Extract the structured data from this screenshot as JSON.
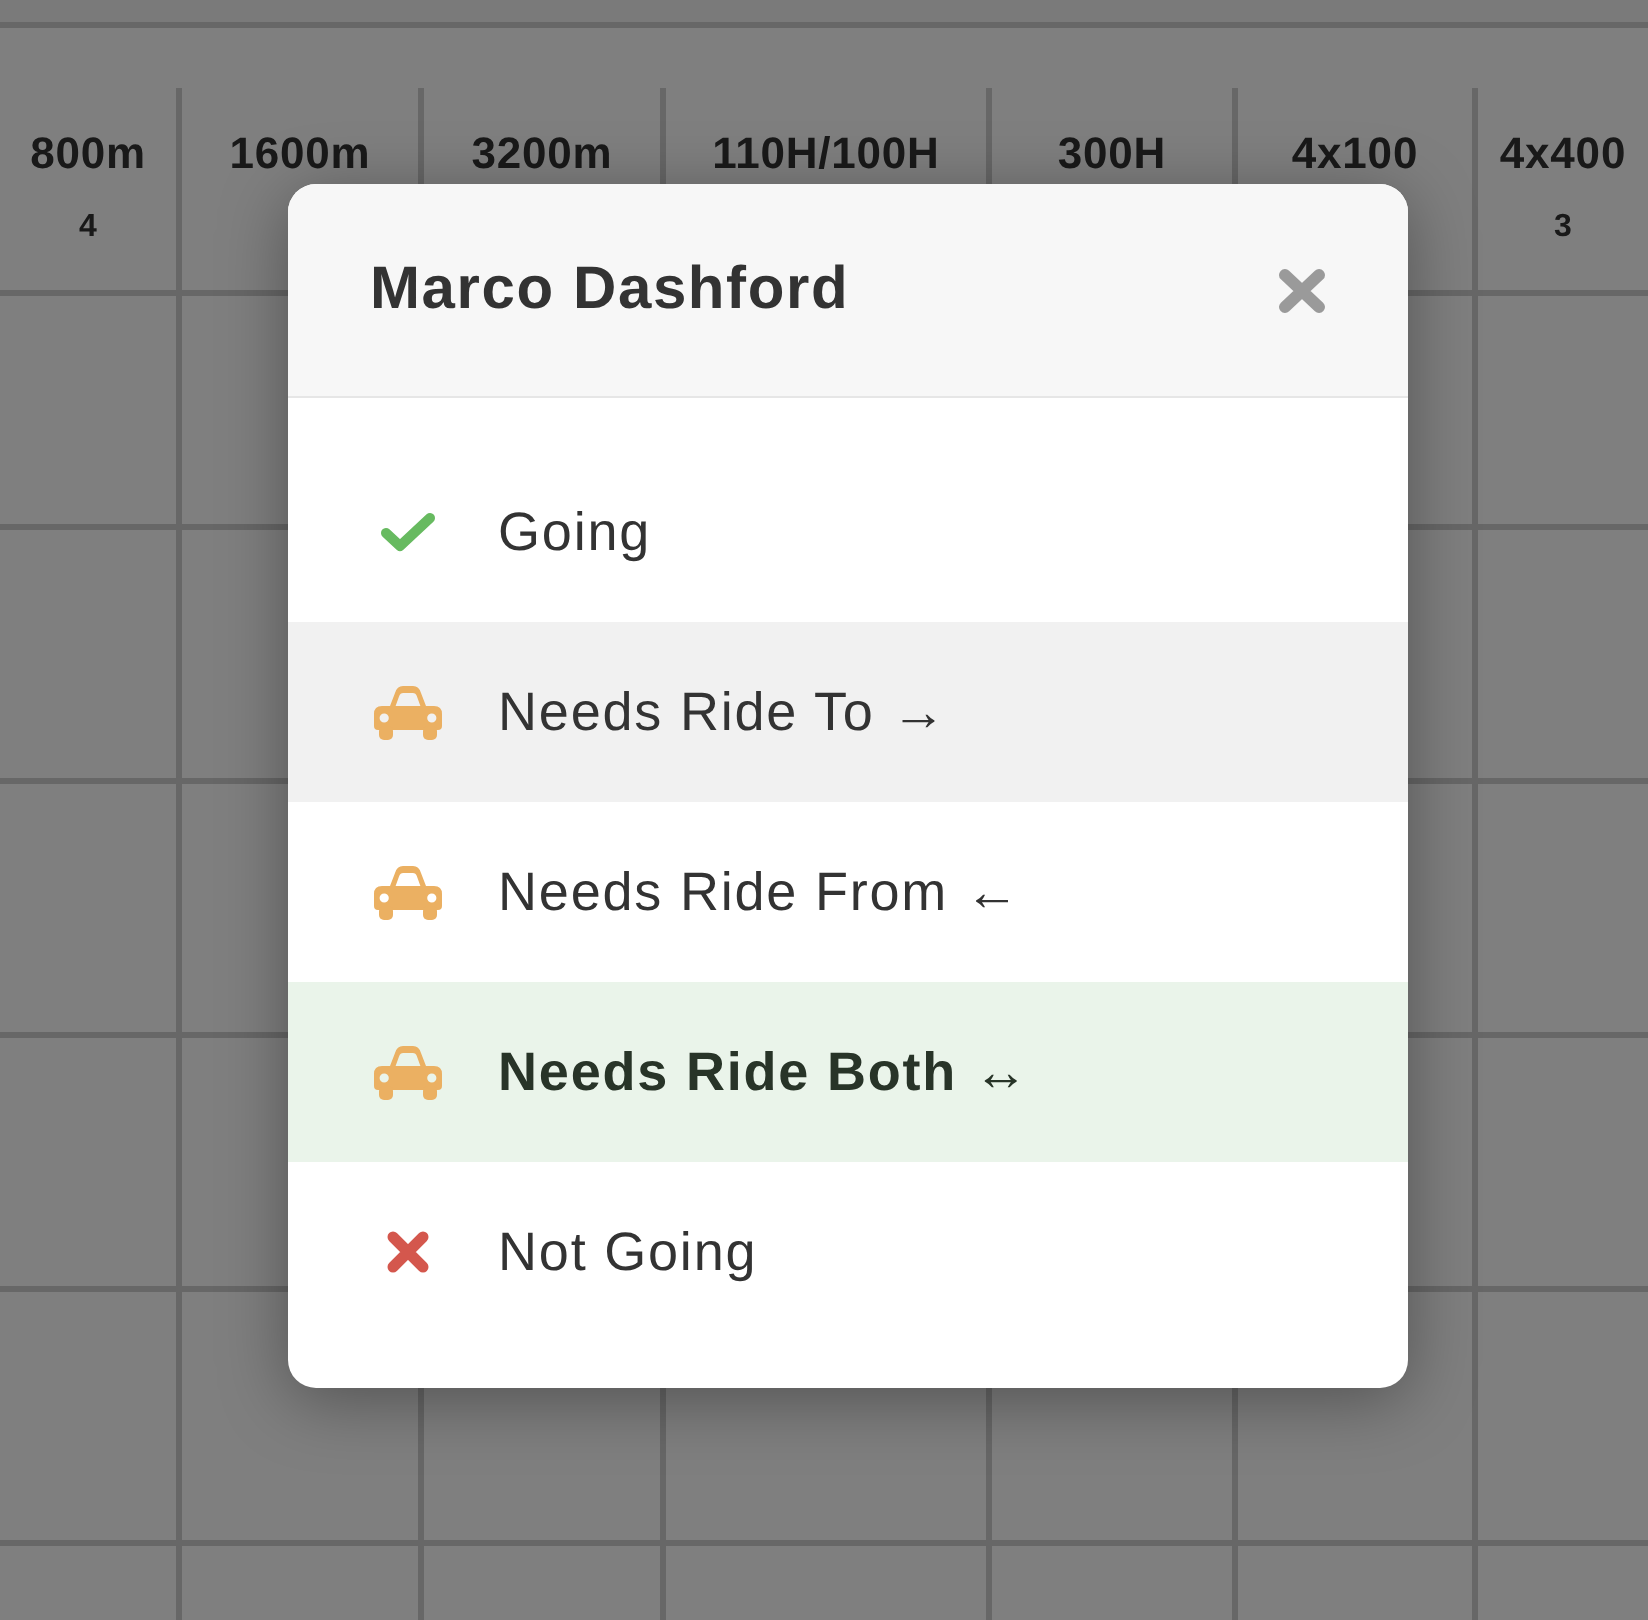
{
  "table": {
    "columns": [
      {
        "title": "800m",
        "count": "4"
      },
      {
        "title": "1600m"
      },
      {
        "title": "3200m"
      },
      {
        "title": "110H/100H"
      },
      {
        "title": "300H"
      },
      {
        "title": "4x100"
      },
      {
        "title": "4x400",
        "count": "3"
      }
    ]
  },
  "dialog": {
    "title": "Marco Dashford",
    "options": [
      {
        "kind": "going",
        "label": "Going",
        "selected": false,
        "hovered": false
      },
      {
        "kind": "ride",
        "label": "Needs Ride To →",
        "selected": false,
        "hovered": true
      },
      {
        "kind": "ride",
        "label": "Needs Ride From ←",
        "selected": false,
        "hovered": false
      },
      {
        "kind": "ride",
        "label": "Needs Ride Both ↔",
        "selected": true,
        "hovered": false
      },
      {
        "kind": "not-going",
        "label": "Not Going",
        "selected": false,
        "hovered": false
      }
    ]
  }
}
